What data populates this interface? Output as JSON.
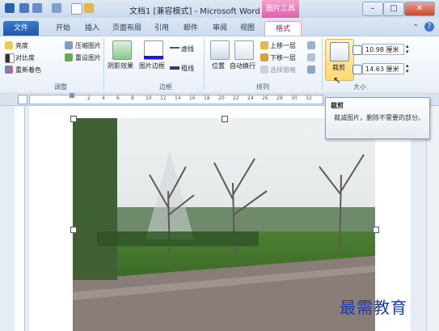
{
  "window": {
    "title": "文档1 [兼容模式] - Microsoft Word",
    "context_tab": "图片工具"
  },
  "tabs": [
    "文件",
    "开始",
    "插入",
    "页面布局",
    "引用",
    "邮件",
    "审阅",
    "视图",
    "格式"
  ],
  "ribbon": {
    "adjust": {
      "brightness": "亮度",
      "contrast": "对比度",
      "recolor": "重新着色",
      "compress": "压缩图片",
      "reset": "重设图片",
      "group": "调整"
    },
    "border": {
      "shadow": "阴影效果",
      "picture_border": "图片边框",
      "dashes": "虚线",
      "weight": "粗线",
      "group": "边框"
    },
    "arrange": {
      "position": "位置",
      "wrap": "自动换行",
      "bring_forward": "上移一层",
      "send_backward": "下移一层",
      "selection_pane": "选择窗格",
      "group": "排列"
    },
    "size": {
      "crop": "裁剪",
      "height": "10.98 厘米",
      "width": "14.63 厘米",
      "group": "大小"
    }
  },
  "ruler": {
    "marks": [
      "2",
      "4",
      "6",
      "8",
      "10",
      "12",
      "14",
      "16",
      "18",
      "20",
      "22",
      "24",
      "26",
      "28",
      "30",
      "32"
    ]
  },
  "tooltip": {
    "title": "裁剪",
    "desc": "裁减图片，删除不需要的部分。"
  },
  "watermark": "最需教育",
  "colors": {
    "accent": "#2b579a",
    "context": "#de5ea8",
    "crop_highlight": "#ffd76e"
  }
}
